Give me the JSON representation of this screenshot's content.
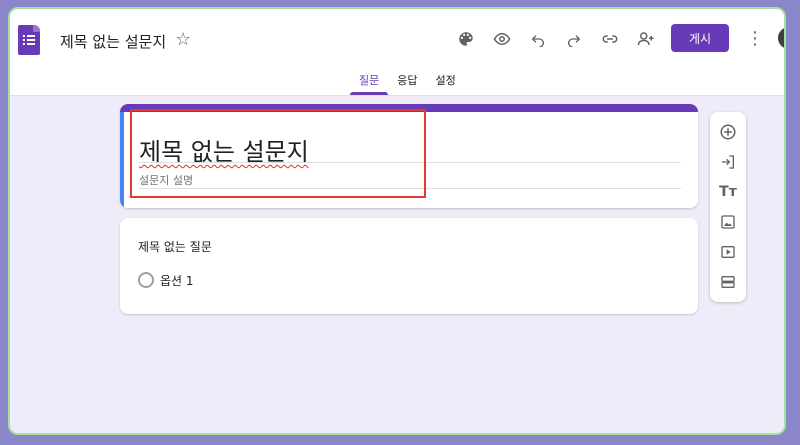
{
  "header": {
    "doc_title": "제목 없는 설문지",
    "publish_label": "게시",
    "icons": [
      "palette-icon",
      "preview-eye-icon",
      "undo-icon",
      "redo-icon",
      "link-icon",
      "add-collaborator-icon"
    ]
  },
  "tabs": [
    {
      "label": "질문",
      "active": true
    },
    {
      "label": "응답",
      "active": false
    },
    {
      "label": "설정",
      "active": false
    }
  ],
  "form": {
    "title": "제목 없는 설문지",
    "description_placeholder": "설문지 설명"
  },
  "question": {
    "title": "제목 없는 질문",
    "options": [
      "옵션 1"
    ]
  },
  "side_toolbar": {
    "icons": [
      "add-question-icon",
      "import-questions-icon",
      "add-title-icon",
      "add-image-icon",
      "add-video-icon",
      "add-section-icon"
    ]
  },
  "colors": {
    "accent": "#673ab7",
    "highlight": "#e53935",
    "canvas": "#efebf8"
  }
}
